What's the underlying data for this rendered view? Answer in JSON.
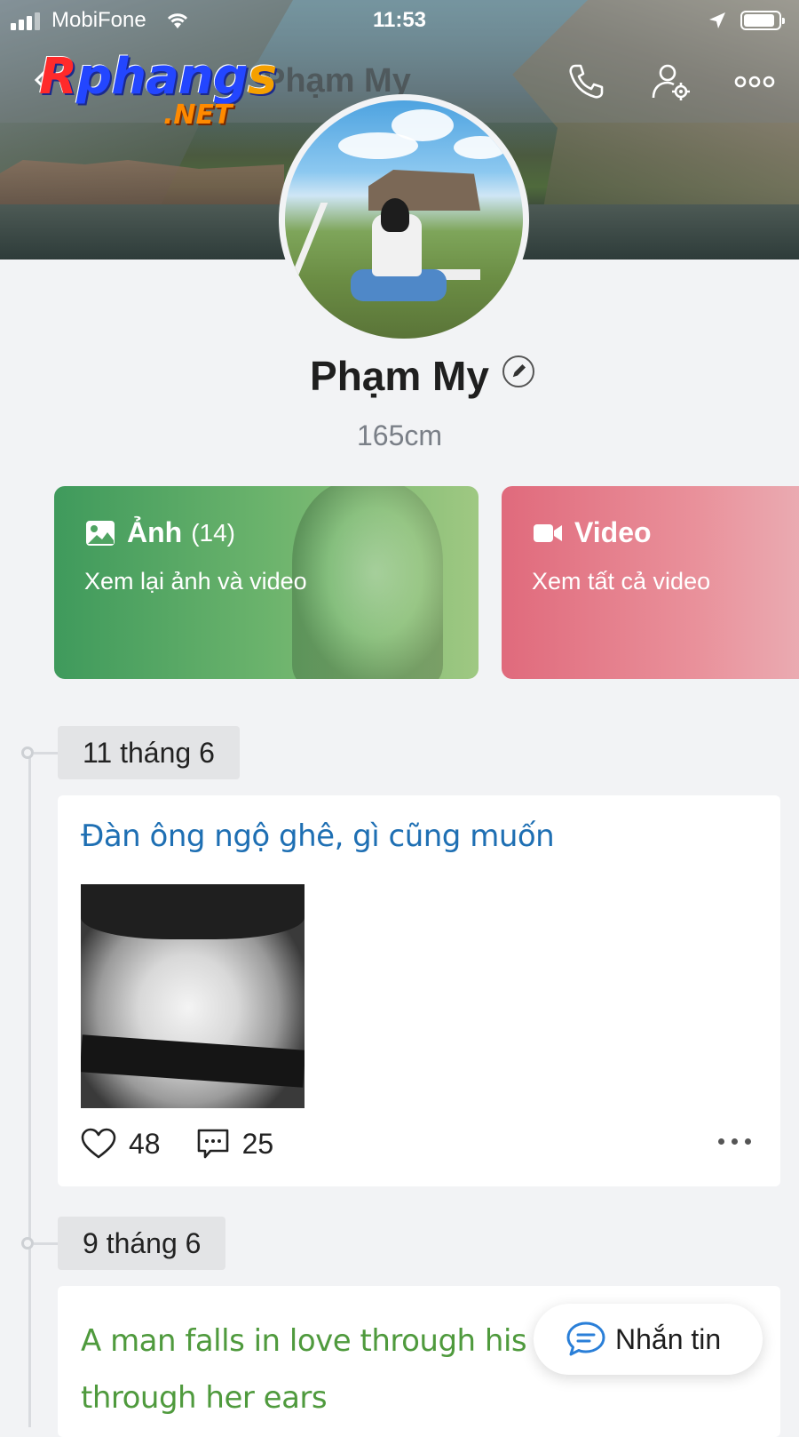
{
  "status_bar": {
    "carrier": "MobiFone",
    "time": "11:53",
    "icons": [
      "signal-icon",
      "wifi-icon",
      "location-arrow-icon",
      "battery-icon"
    ]
  },
  "header": {
    "logo_main": "Rphangs",
    "logo_suffix": ".NET",
    "title": "Phạm My",
    "icons": [
      "back-icon",
      "phone-icon",
      "user-settings-icon",
      "more-icon"
    ]
  },
  "profile": {
    "name": "Phạm My",
    "subtitle": "165cm"
  },
  "cards": {
    "photos": {
      "title": "Ảnh",
      "count": "(14)",
      "subtitle": "Xem lại ảnh và video",
      "icon": "image-icon",
      "color": "#4fa462"
    },
    "videos": {
      "title": "Video",
      "subtitle": "Xem tất cả video",
      "icon": "video-camera-icon",
      "color": "#e06a7c"
    }
  },
  "timeline": [
    {
      "date": "11 tháng 6",
      "text": "Đàn ông ngộ ghê, gì cũng muốn",
      "text_color": "#1e6fb3",
      "likes": "48",
      "comments": "25"
    },
    {
      "date": "9 tháng 6",
      "text": "A man falls in love through his eye... through her ears",
      "text_line1": "A man falls in love through his eye",
      "text_line2": "through her ears",
      "text_color": "#4f9a3d"
    }
  ],
  "message_button": {
    "label": "Nhắn tin",
    "icon": "chat-icon",
    "accent": "#2a7fd8"
  }
}
